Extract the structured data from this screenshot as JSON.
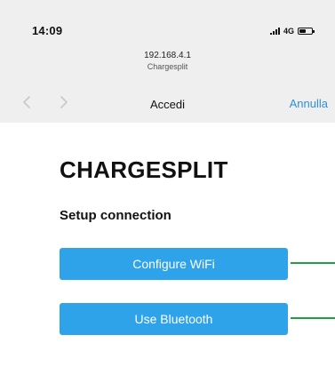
{
  "status_bar": {
    "time": "14:09",
    "network": "4G",
    "icons": [
      "signal-icon",
      "battery-icon"
    ]
  },
  "browser": {
    "host": "192.168.4.1",
    "page_name": "Chargesplit",
    "title": "Accedi",
    "cancel_label": "Annulla",
    "icons": [
      "back-arrow-icon",
      "forward-arrow-icon"
    ]
  },
  "page": {
    "title": "CHARGESPLIT",
    "section_heading": "Setup connection",
    "buttons": {
      "wifi": "Configure WiFi",
      "bluetooth": "Use Bluetooth"
    }
  },
  "colors": {
    "top_frame": "#efefef",
    "content_background": "#ffffff",
    "button": "#2fa3ea",
    "link": "#2f8fdd",
    "callout_line": "#1f9e45"
  }
}
